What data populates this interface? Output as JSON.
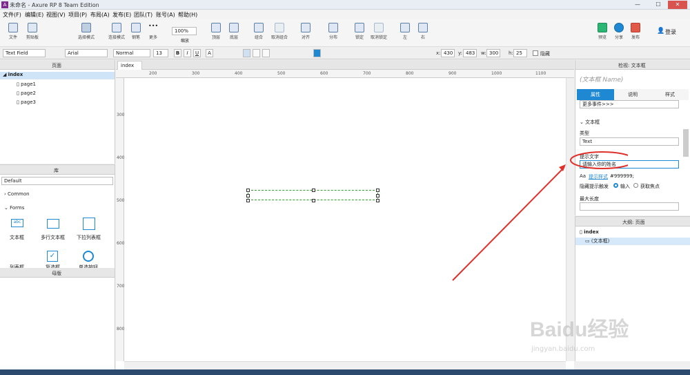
{
  "window": {
    "title": "未命名 - Axure RP 8 Team Edition",
    "logo": "A",
    "btn_minimize": "—",
    "btn_maximize": "☐",
    "btn_close": "✕"
  },
  "menu": [
    "文件(F)",
    "编辑(E)",
    "视图(V)",
    "项目(P)",
    "布局(A)",
    "发布(E)",
    "团队(T)",
    "账号(A)",
    "帮助(H)"
  ],
  "toolbar": {
    "file": "文件",
    "clipboard": "剪贴板",
    "select_mode": "选择模式",
    "connect_mode": "连接模式",
    "pen": "钢笔",
    "more": "更多",
    "zoom_value": "100%",
    "zoom_label": "缩放",
    "top": "顶层",
    "bottom": "底层",
    "group": "组合",
    "ungroup": "取消组合",
    "align": "对齐",
    "distribute": "分布",
    "lock": "锁定",
    "unlock": "取消锁定",
    "left": "左",
    "right": "右",
    "preview": "预览",
    "share": "分享",
    "publish": "发布",
    "login": "登录"
  },
  "format": {
    "widget_type": "Text Field",
    "font": "Arial",
    "weight": "Normal",
    "size": "13",
    "x_label": "x:",
    "x": "430",
    "y_label": "y:",
    "y": "483",
    "w_label": "w:",
    "w": "300",
    "h_label": "h:",
    "h": "25",
    "hidden": "隐藏",
    "bold": "B",
    "italic": "I",
    "underline": "U",
    "font_color": "A"
  },
  "pages_panel": {
    "title": "页面",
    "items": [
      "index",
      "page1",
      "page2",
      "page3"
    ]
  },
  "library_panel": {
    "title": "库",
    "select": "Default",
    "common": "Common",
    "forms": "Forms",
    "widgets": [
      "文本框",
      "多行文本框",
      "下拉列表框",
      "列表框",
      "复选框",
      "单选按钮"
    ]
  },
  "masters_panel": {
    "title": "母版"
  },
  "canvas": {
    "tab": "index",
    "ruler_h": [
      "200",
      "300",
      "400",
      "500",
      "600",
      "700",
      "800",
      "900",
      "1000",
      "1100"
    ],
    "ruler_v": [
      "300",
      "400",
      "500",
      "600",
      "700",
      "800"
    ]
  },
  "inspector": {
    "title": "检视: 文本框",
    "name_placeholder": "(文本框 Name)",
    "tabs": [
      "属性",
      "说明",
      "样式"
    ],
    "events": "更多事件>>>",
    "section": "文本框",
    "type_label": "类型",
    "type_value": "Text",
    "hint_label": "提示文字",
    "hint_value": "请输入你的姓名",
    "hint_style_link": "提示样式",
    "hint_color": "#999999;",
    "hide_hint_label": "隐藏提示触发",
    "radio_input": "输入",
    "radio_focus": "获取焦点",
    "maxlen_label": "最大长度"
  },
  "outline": {
    "title": "大纲: 页面",
    "root": "index",
    "child": "(文本框)"
  },
  "watermark": {
    "brand": "Baidu经验",
    "url": "jingyan.baidu.com"
  },
  "colors": {
    "accent": "#1e88d2",
    "annotation": "#e0302a",
    "selection": "#2e9a2e"
  }
}
